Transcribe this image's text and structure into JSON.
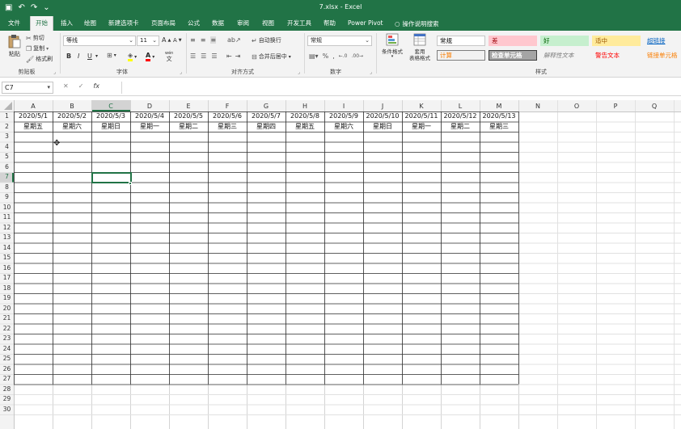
{
  "titlebar": {
    "title": "7.xlsx  -  Excel",
    "qat_icons": [
      "save-icon",
      "undo-icon",
      "redo-icon",
      "customize-qat-icon"
    ],
    "qat_glyphs": [
      "▣",
      "↶",
      "↷",
      "⌄"
    ],
    "accent": "#217346"
  },
  "tabs": [
    {
      "label": "文件"
    },
    {
      "label": "开始",
      "active": true
    },
    {
      "label": "插入"
    },
    {
      "label": "绘图"
    },
    {
      "label": "新建选项卡"
    },
    {
      "label": "页面布局"
    },
    {
      "label": "公式"
    },
    {
      "label": "数据"
    },
    {
      "label": "审阅"
    },
    {
      "label": "视图"
    },
    {
      "label": "开发工具"
    },
    {
      "label": "帮助"
    },
    {
      "label": "Power Pivot"
    },
    {
      "label": "操作说明搜索"
    }
  ],
  "ribbon": {
    "clipboard": {
      "paste": "粘贴",
      "cut": "剪切",
      "copy": "复制",
      "format_painter": "格式刷",
      "group": "剪贴板"
    },
    "font": {
      "name": "等线",
      "size": "11",
      "group": "字体",
      "bold": "B",
      "italic": "I",
      "underline": "U",
      "grow": "A",
      "shrink": "A",
      "wen": "wén",
      "font_color": "A"
    },
    "alignment": {
      "wrap": "自动换行",
      "merge": "合并后居中",
      "group": "对齐方式"
    },
    "number": {
      "format": "常规",
      "percent": "%",
      "comma": ",",
      "group": "数字"
    },
    "styles": {
      "conditional": "条件格式",
      "table_format_1": "套用",
      "table_format_2": "表格格式",
      "group": "样式",
      "boxes": [
        {
          "label": "常规",
          "bg": "#ffffff",
          "fg": "#000000",
          "border": "#c6c6c6"
        },
        {
          "label": "差",
          "bg": "#ffc7ce",
          "fg": "#9c0006",
          "border": "#ffc7ce"
        },
        {
          "label": "好",
          "bg": "#c6efce",
          "fg": "#006100",
          "border": "#c6efce"
        },
        {
          "label": "适中",
          "bg": "#ffeb9c",
          "fg": "#9c5700",
          "border": "#ffeb9c"
        },
        {
          "label": "超链接",
          "bg": "#f3f3f3",
          "fg": "#0563c1",
          "border": "#f3f3f3"
        },
        {
          "label": "计算",
          "bg": "#f2f2f2",
          "fg": "#fa7d00",
          "border": "#7f7f7f"
        },
        {
          "label": "检查单元格",
          "bg": "#a5a5a5",
          "fg": "#ffffff",
          "border": "#3f3f3f"
        },
        {
          "label": "解释性文本",
          "bg": "#f3f3f3",
          "fg": "#7f7f7f",
          "border": "#f3f3f3"
        },
        {
          "label": "警告文本",
          "bg": "#f3f3f3",
          "fg": "#ff0000",
          "border": "#f3f3f3"
        },
        {
          "label": "链接单元格",
          "bg": "#f3f3f3",
          "fg": "#fa7d00",
          "border": "#f3f3f3"
        }
      ]
    }
  },
  "formula_bar": {
    "name_box": "C7",
    "cancel": "✕",
    "enter": "✓",
    "fx": "fx",
    "content": ""
  },
  "sheet": {
    "columns": [
      "A",
      "B",
      "C",
      "D",
      "E",
      "F",
      "G",
      "H",
      "I",
      "J",
      "K",
      "L",
      "M",
      "N",
      "O",
      "P",
      "Q"
    ],
    "selected_column": "C",
    "selected_row": 7,
    "row_count": 30,
    "row1": [
      "2020/5/1",
      "2020/5/2",
      "2020/5/3",
      "2020/5/4",
      "2020/5/5",
      "2020/5/6",
      "2020/5/7",
      "2020/5/8",
      "2020/5/9",
      "2020/5/10",
      "2020/5/11",
      "2020/5/12",
      "2020/5/13"
    ],
    "row2": [
      "星期五",
      "星期六",
      "星期日",
      "星期一",
      "星期二",
      "星期三",
      "星期四",
      "星期五",
      "星期六",
      "星期日",
      "星期一",
      "星期二",
      "星期三"
    ],
    "bordered_rows": 27,
    "bordered_cols": 13
  }
}
